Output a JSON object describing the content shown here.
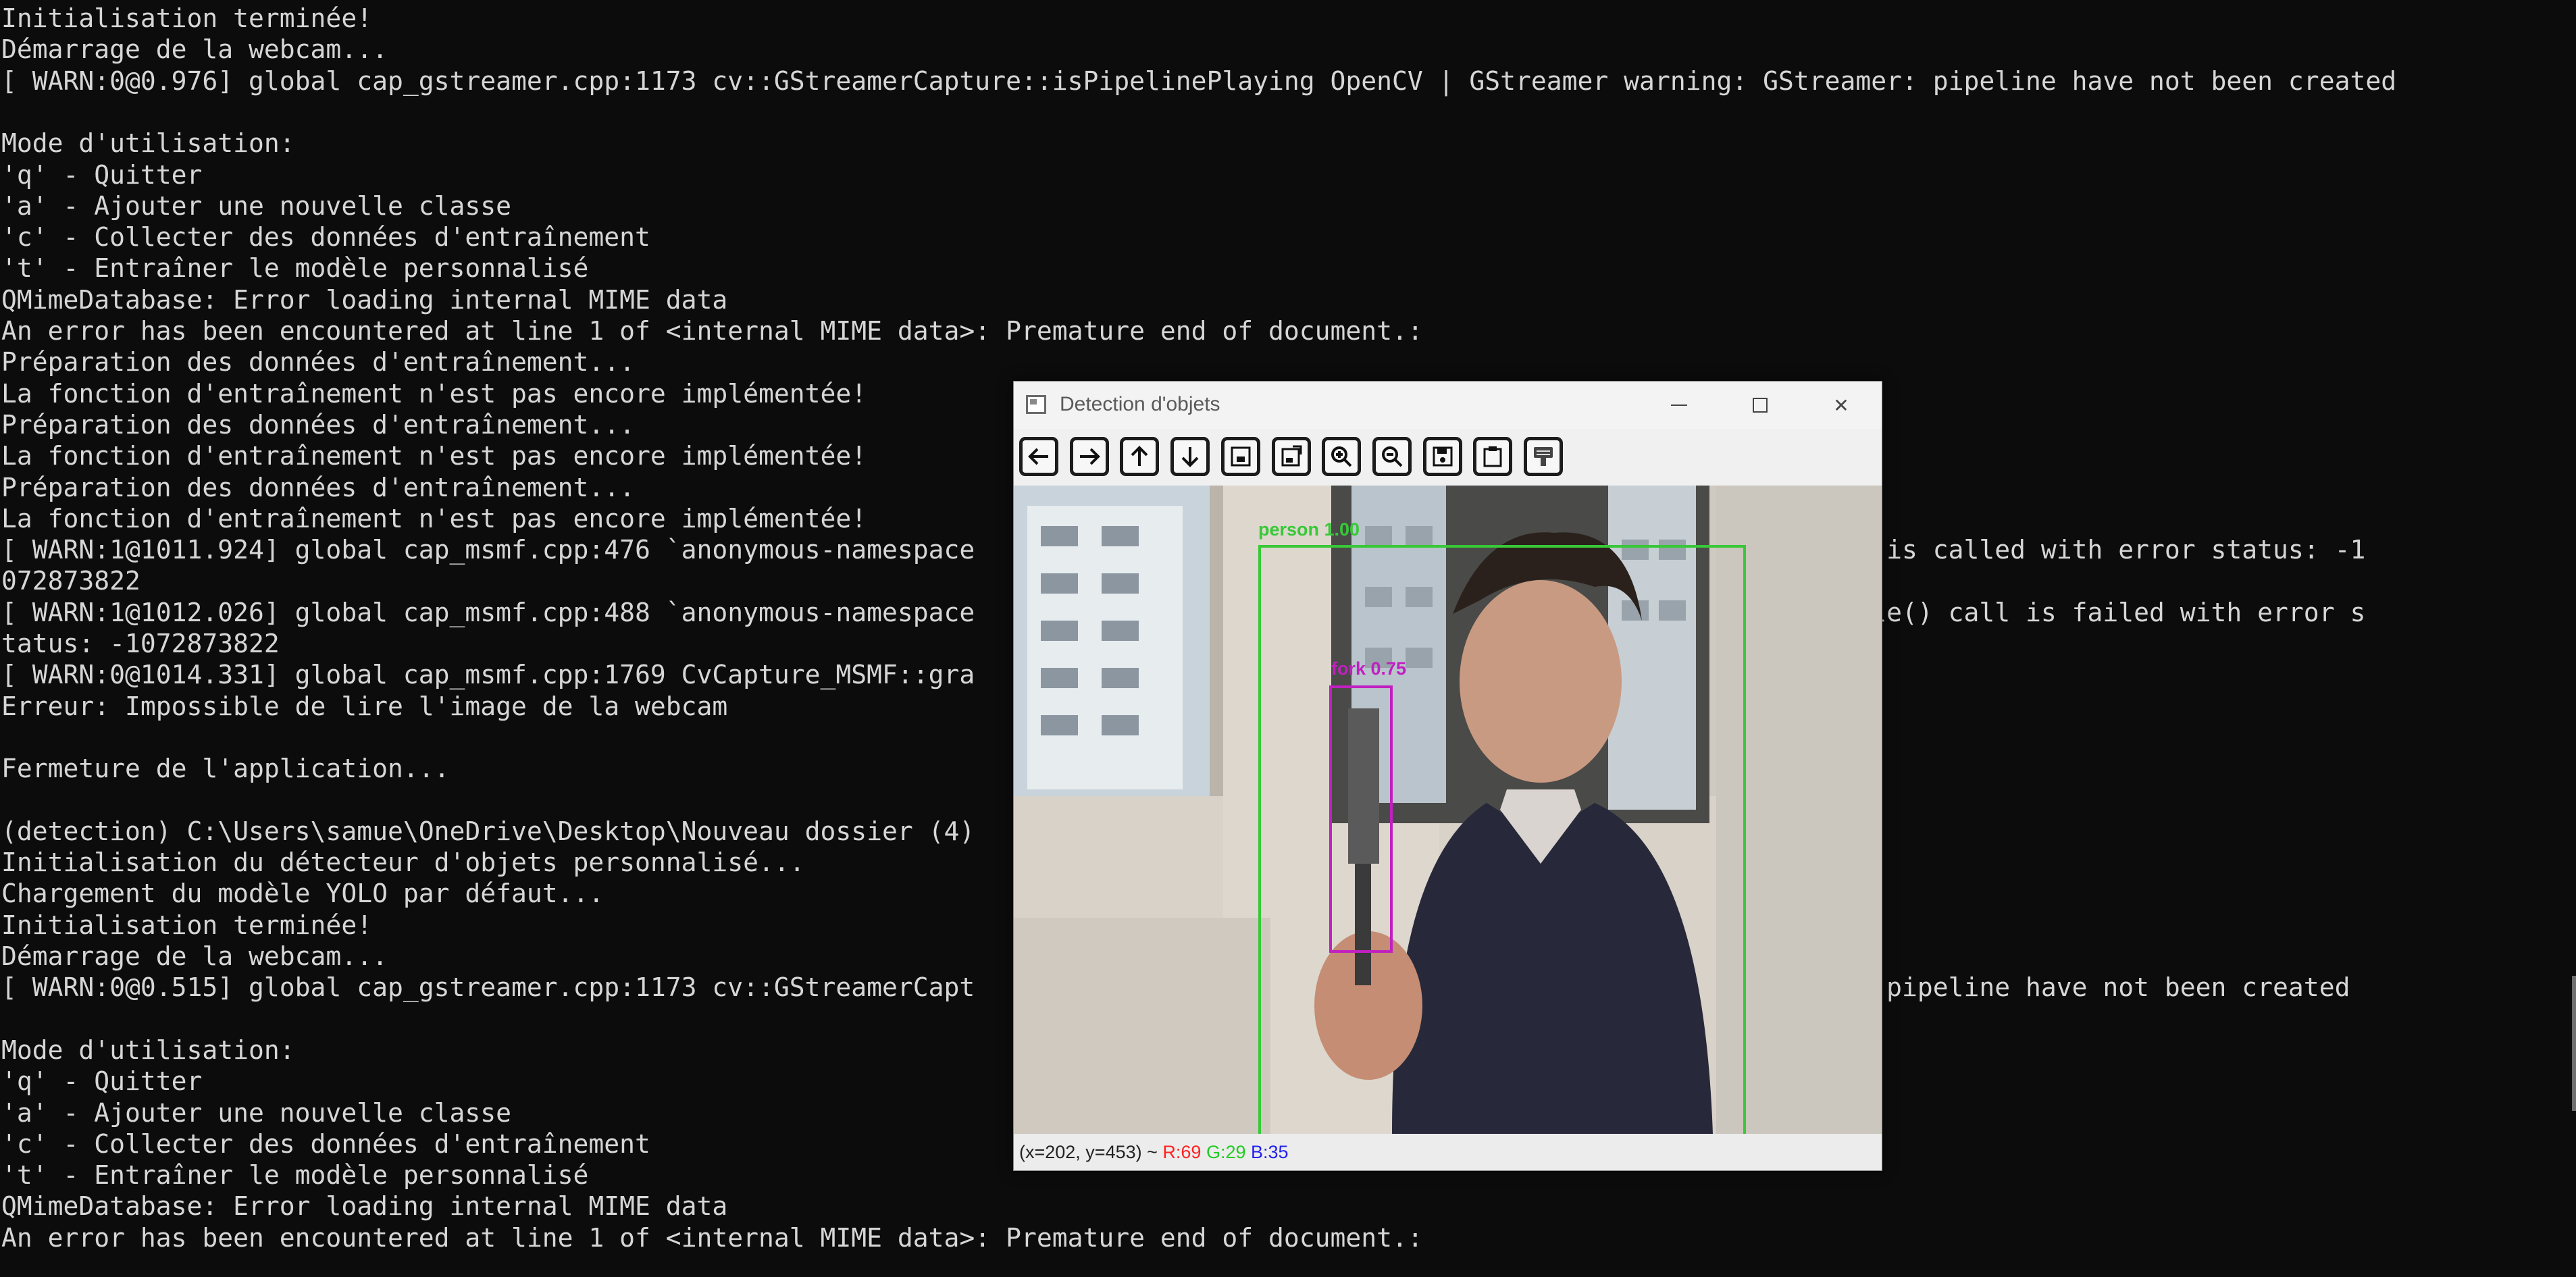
{
  "terminal": {
    "lines": [
      "Initialisation terminée!",
      "Démarrage de la webcam...",
      "[ WARN:0@0.976] global cap_gstreamer.cpp:1173 cv::GStreamerCapture::isPipelinePlaying OpenCV | GStreamer warning: GStreamer: pipeline have not been created",
      "",
      "Mode d'utilisation:",
      "'q' - Quitter",
      "'a' - Ajouter une nouvelle classe",
      "'c' - Collecter des données d'entraînement",
      "'t' - Entraîner le modèle personnalisé",
      "QMimeDatabase: Error loading internal MIME data",
      "An error has been encountered at line 1 of <internal MIME data>: Premature end of document.:",
      "Préparation des données d'entraînement...",
      "La fonction d'entraînement n'est pas encore implémentée!",
      "Préparation des données d'entraînement...",
      "La fonction d'entraînement n'est pas encore implémentée!",
      "Préparation des données d'entraînement...",
      "La fonction d'entraînement n'est pas encore implémentée!",
      "[ WARN:1@1011.924] global cap_msmf.cpp:476 `anonymous-namespace                                                  Sample() is called with error status: -1",
      "072873822",
      "[ WARN:1@1012.026] global cap_msmf.cpp:488 `anonymous-namespace                                                  ReadSample() call is failed with error s",
      "tatus: -1072873822",
      "[ WARN:0@1014.331] global cap_msmf.cpp:1769 CvCapture_MSMF::gra                                                  73822",
      "Erreur: Impossible de lire l'image de la webcam",
      "",
      "Fermeture de l'application...",
      "",
      "(detection) C:\\Users\\samue\\OneDrive\\Desktop\\Nouveau dossier (4)",
      "Initialisation du détecteur d'objets personnalisé...",
      "Chargement du modèle YOLO par défaut...",
      "Initialisation terminée!",
      "Démarrage de la webcam...",
      "[ WARN:0@0.515] global cap_gstreamer.cpp:1173 cv::GStreamerCapt                                                  treamer: pipeline have not been created",
      "",
      "Mode d'utilisation:",
      "'q' - Quitter",
      "'a' - Ajouter une nouvelle classe",
      "'c' - Collecter des données d'entraînement",
      "'t' - Entraîner le modèle personnalisé",
      "QMimeDatabase: Error loading internal MIME data",
      "An error has been encountered at line 1 of <internal MIME data>: Premature end of document.:"
    ]
  },
  "window": {
    "title": "Detection d'objets",
    "toolbar": [
      {
        "icon": "arrow-left-icon"
      },
      {
        "icon": "arrow-right-icon"
      },
      {
        "icon": "arrow-up-icon"
      },
      {
        "icon": "arrow-down-icon"
      },
      {
        "icon": "zoom-fit-icon"
      },
      {
        "icon": "zoom-original-icon"
      },
      {
        "icon": "zoom-in-icon"
      },
      {
        "icon": "zoom-out-icon"
      },
      {
        "icon": "save-icon"
      },
      {
        "icon": "properties-icon"
      },
      {
        "icon": "options-icon"
      }
    ],
    "detections": [
      {
        "label": "person 1.00",
        "color": "#38c838"
      },
      {
        "label": "fork 0.75",
        "color": "#c020c0"
      }
    ],
    "status": {
      "coords": "(x=202, y=453) ~",
      "r": "R:69",
      "g": "G:29",
      "b": "B:35"
    }
  }
}
